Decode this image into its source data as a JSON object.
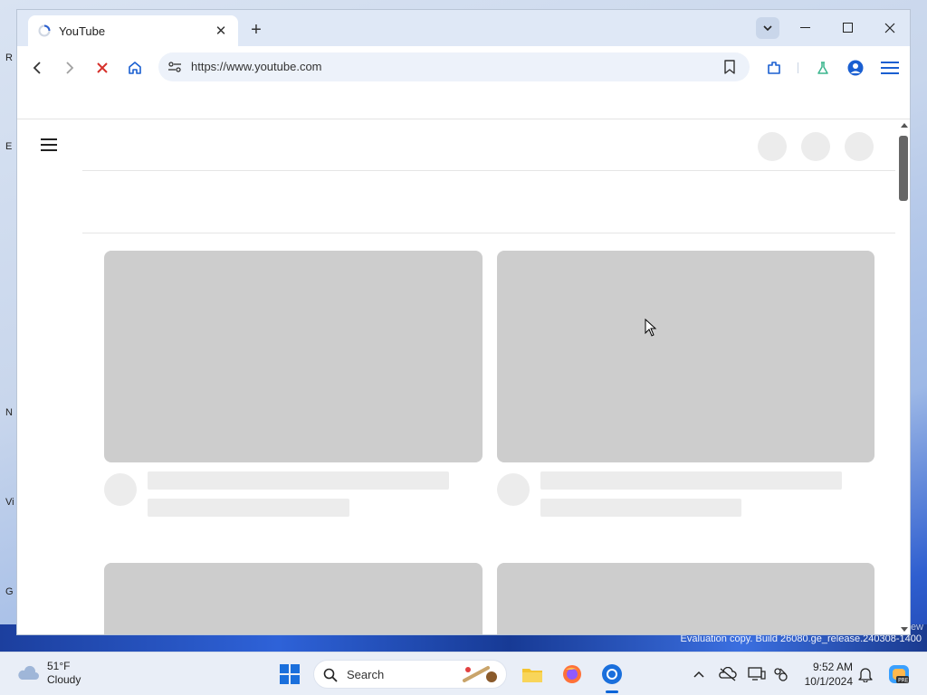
{
  "desktop": {
    "edge_labels": [
      "R",
      "E",
      "N",
      "Vi",
      "G"
    ],
    "watermark": "Evaluation copy. Build 26080.ge_release.240308-1400",
    "watermark_fragment": "ew"
  },
  "browser": {
    "tab": {
      "title": "YouTube"
    },
    "address": {
      "url": "https://www.youtube.com"
    }
  },
  "taskbar": {
    "weather": {
      "temp": "51°F",
      "condition": "Cloudy"
    },
    "search_label": "Search",
    "clock": {
      "time": "9:52 AM",
      "date": "10/1/2024"
    }
  },
  "colors": {
    "accent": "#0a64d8",
    "skeleton_card": "#cdcdcd",
    "skeleton_line": "#ececec"
  }
}
